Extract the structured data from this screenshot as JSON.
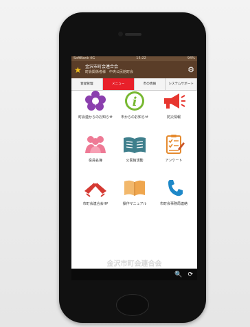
{
  "status": {
    "carrier": "SoftBank 4G",
    "time": "15:22",
    "battery": "94%"
  },
  "appbar": {
    "title": "金沢市町会連合会",
    "subtitle": "町会関係者様　中央公民館町会"
  },
  "tabs": [
    {
      "label": "登録管理"
    },
    {
      "label": "メニュー"
    },
    {
      "label": "市の情報"
    },
    {
      "label": "システムサポート"
    }
  ],
  "menu": [
    {
      "label": "町会連からのお知らせ",
      "icon": "flower-icon"
    },
    {
      "label": "市からのお知らせ",
      "icon": "info-icon"
    },
    {
      "label": "防災情報",
      "icon": "megaphone-icon"
    },
    {
      "label": "役員名簿",
      "icon": "people-icon"
    },
    {
      "label": "公民館活動",
      "icon": "book-icon"
    },
    {
      "label": "アンケート",
      "icon": "survey-icon"
    },
    {
      "label": "市町会連合会HP",
      "icon": "flag-icon"
    },
    {
      "label": "操作マニュアル",
      "icon": "manual-icon"
    },
    {
      "label": "市町会事務局連絡",
      "icon": "phone-icon"
    }
  ],
  "footer": {
    "watermark": "金沢市町会連合会"
  }
}
